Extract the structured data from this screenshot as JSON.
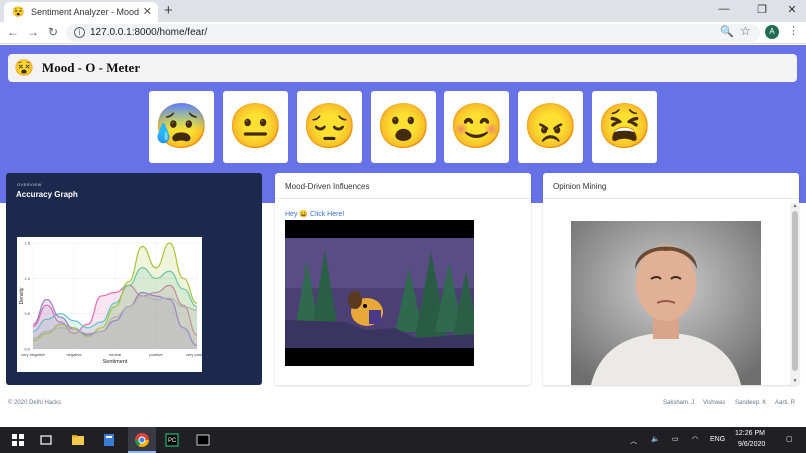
{
  "browser": {
    "tab_title": "Sentiment Analyzer - Mood - O",
    "tab_favicon": "😵",
    "tab_close": "✕",
    "new_tab": "+",
    "minimize": "—",
    "restore": "❐",
    "close": "✕",
    "url": "127.0.0.1:8000/home/fear/",
    "back": "←",
    "forward": "→",
    "reload": "↻",
    "zoom": "🔍",
    "bookmark": "☆",
    "profile_initial": "A",
    "menu": "⋮"
  },
  "app": {
    "brand_icon": "😵",
    "brand": "Mood - O - Meter"
  },
  "moods": [
    {
      "name": "fear",
      "glyph": "😰"
    },
    {
      "name": "neutral",
      "glyph": "😐"
    },
    {
      "name": "sad",
      "glyph": "😔"
    },
    {
      "name": "surprise",
      "glyph": "😮"
    },
    {
      "name": "happy",
      "glyph": "😊"
    },
    {
      "name": "angry",
      "glyph": "😠"
    },
    {
      "name": "disgust",
      "glyph": "😫"
    }
  ],
  "panels": {
    "overview_label": "OVERVIEW",
    "accuracy_title": "Accuracy Graph",
    "influences_title": "Mood-Driven Influences",
    "influences_link": "Hey 😀 Click Here!",
    "opinion_title": "Opinion Mining"
  },
  "chart_data": {
    "type": "area",
    "xlabel": "Sentiment",
    "ylabel": "Density",
    "categories": [
      "very negative",
      "negative",
      "neutral",
      "positive",
      "very positive"
    ],
    "yticks": [
      "0.0",
      "0.5",
      "1.0",
      "1.5"
    ],
    "ylim": [
      0,
      1.5
    ],
    "series": [
      {
        "color": "#e06bb0",
        "values": [
          0.32,
          0.62,
          0.38,
          0.22,
          0.35,
          0.75,
          0.8,
          0.9,
          0.75,
          0.8,
          0.9,
          0.62,
          0.2
        ]
      },
      {
        "color": "#5ec6c3",
        "values": [
          0.25,
          0.42,
          0.5,
          0.4,
          0.3,
          0.38,
          0.65,
          0.9,
          1.15,
          1.0,
          1.1,
          0.85,
          0.6
        ]
      },
      {
        "color": "#a7c43a",
        "values": [
          0.12,
          0.22,
          0.35,
          0.3,
          0.18,
          0.3,
          0.6,
          0.95,
          1.45,
          1.15,
          1.5,
          1.0,
          0.65
        ]
      },
      {
        "color": "#9a7ec4",
        "values": [
          0.35,
          0.7,
          0.45,
          0.28,
          0.2,
          0.25,
          0.4,
          0.6,
          0.8,
          0.75,
          0.7,
          0.3,
          0.05
        ]
      },
      {
        "color": "#b0b0b0",
        "values": [
          0.15,
          0.25,
          0.3,
          0.28,
          0.22,
          0.25,
          0.45,
          0.6,
          0.75,
          0.7,
          0.72,
          0.6,
          0.55
        ]
      }
    ]
  },
  "footer": {
    "copyright": "© 2020 Delhi Hacks",
    "members": [
      "Saksham. J",
      "Vishwas",
      "Sandeep. K",
      "Aarti. R"
    ]
  },
  "taskbar": {
    "time": "12:26 PM",
    "date": "9/6/2020",
    "lang": "ENG"
  }
}
